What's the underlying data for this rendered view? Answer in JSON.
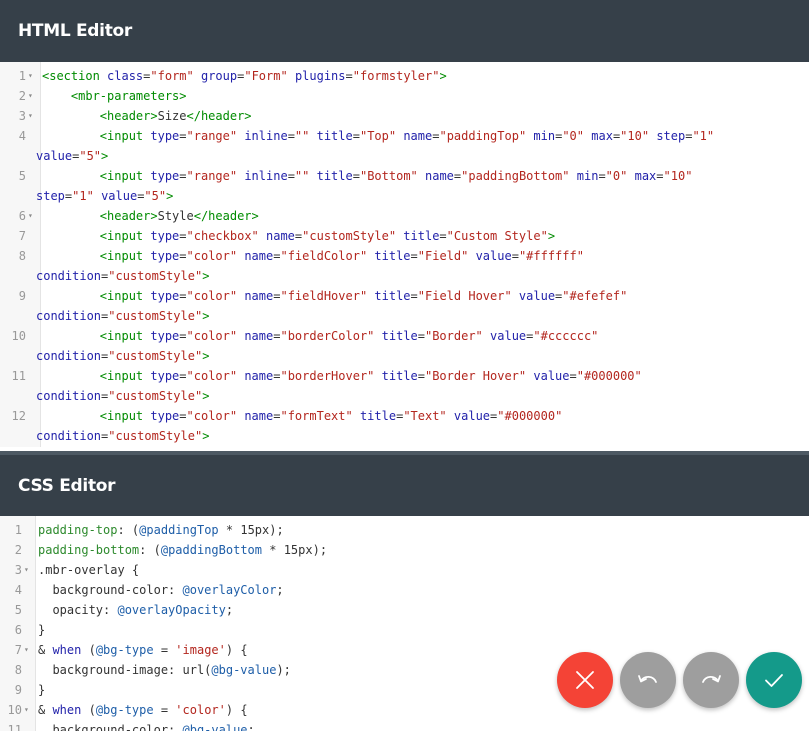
{
  "html_editor": {
    "title": "HTML Editor",
    "lines": [
      {
        "n": "1",
        "fold": true,
        "segments": [
          [
            "t-tag",
            "<section "
          ],
          [
            "t-attr",
            "class"
          ],
          [
            "t-text",
            "="
          ],
          [
            "t-val",
            "\"form\""
          ],
          [
            "t-text",
            " "
          ],
          [
            "t-attr",
            "group"
          ],
          [
            "t-text",
            "="
          ],
          [
            "t-val",
            "\"Form\""
          ],
          [
            "t-text",
            " "
          ],
          [
            "t-attr",
            "plugins"
          ],
          [
            "t-text",
            "="
          ],
          [
            "t-val",
            "\"formstyler\""
          ],
          [
            "t-tag",
            ">"
          ]
        ]
      },
      {
        "n": "2",
        "fold": true,
        "segments": [
          [
            "t-text",
            "    "
          ],
          [
            "t-tag",
            "<mbr-parameters>"
          ]
        ]
      },
      {
        "n": "3",
        "fold": true,
        "segments": [
          [
            "t-text",
            "        "
          ],
          [
            "t-tag",
            "<header>"
          ],
          [
            "t-text",
            "Size"
          ],
          [
            "t-tag",
            "</header>"
          ]
        ]
      },
      {
        "n": "4",
        "fold": false,
        "segments": [
          [
            "t-text",
            "        "
          ],
          [
            "t-tag",
            "<input "
          ],
          [
            "t-attr",
            "type"
          ],
          [
            "t-text",
            "="
          ],
          [
            "t-val",
            "\"range\""
          ],
          [
            "t-text",
            " "
          ],
          [
            "t-attr",
            "inline"
          ],
          [
            "t-text",
            "="
          ],
          [
            "t-val",
            "\"\""
          ],
          [
            "t-text",
            " "
          ],
          [
            "t-attr",
            "title"
          ],
          [
            "t-text",
            "="
          ],
          [
            "t-val",
            "\"Top\""
          ],
          [
            "t-text",
            " "
          ],
          [
            "t-attr",
            "name"
          ],
          [
            "t-text",
            "="
          ],
          [
            "t-val",
            "\"paddingTop\""
          ],
          [
            "t-text",
            " "
          ],
          [
            "t-attr",
            "min"
          ],
          [
            "t-text",
            "="
          ],
          [
            "t-val",
            "\"0\""
          ],
          [
            "t-text",
            " "
          ],
          [
            "t-attr",
            "max"
          ],
          [
            "t-text",
            "="
          ],
          [
            "t-val",
            "\"10\""
          ],
          [
            "t-text",
            " "
          ],
          [
            "t-attr",
            "step"
          ],
          [
            "t-text",
            "="
          ],
          [
            "t-val",
            "\"1\""
          ]
        ],
        "wrap": [
          [
            "t-attr",
            "value"
          ],
          [
            "t-text",
            "="
          ],
          [
            "t-val",
            "\"5\""
          ],
          [
            "t-tag",
            ">"
          ]
        ]
      },
      {
        "n": "5",
        "fold": false,
        "segments": [
          [
            "t-text",
            "        "
          ],
          [
            "t-tag",
            "<input "
          ],
          [
            "t-attr",
            "type"
          ],
          [
            "t-text",
            "="
          ],
          [
            "t-val",
            "\"range\""
          ],
          [
            "t-text",
            " "
          ],
          [
            "t-attr",
            "inline"
          ],
          [
            "t-text",
            "="
          ],
          [
            "t-val",
            "\"\""
          ],
          [
            "t-text",
            " "
          ],
          [
            "t-attr",
            "title"
          ],
          [
            "t-text",
            "="
          ],
          [
            "t-val",
            "\"Bottom\""
          ],
          [
            "t-text",
            " "
          ],
          [
            "t-attr",
            "name"
          ],
          [
            "t-text",
            "="
          ],
          [
            "t-val",
            "\"paddingBottom\""
          ],
          [
            "t-text",
            " "
          ],
          [
            "t-attr",
            "min"
          ],
          [
            "t-text",
            "="
          ],
          [
            "t-val",
            "\"0\""
          ],
          [
            "t-text",
            " "
          ],
          [
            "t-attr",
            "max"
          ],
          [
            "t-text",
            "="
          ],
          [
            "t-val",
            "\"10\""
          ]
        ],
        "wrap": [
          [
            "t-attr",
            "step"
          ],
          [
            "t-text",
            "="
          ],
          [
            "t-val",
            "\"1\""
          ],
          [
            "t-text",
            " "
          ],
          [
            "t-attr",
            "value"
          ],
          [
            "t-text",
            "="
          ],
          [
            "t-val",
            "\"5\""
          ],
          [
            "t-tag",
            ">"
          ]
        ]
      },
      {
        "n": "6",
        "fold": true,
        "segments": [
          [
            "t-text",
            "        "
          ],
          [
            "t-tag",
            "<header>"
          ],
          [
            "t-text",
            "Style"
          ],
          [
            "t-tag",
            "</header>"
          ]
        ]
      },
      {
        "n": "7",
        "fold": false,
        "segments": [
          [
            "t-text",
            "        "
          ],
          [
            "t-tag",
            "<input "
          ],
          [
            "t-attr",
            "type"
          ],
          [
            "t-text",
            "="
          ],
          [
            "t-val",
            "\"checkbox\""
          ],
          [
            "t-text",
            " "
          ],
          [
            "t-attr",
            "name"
          ],
          [
            "t-text",
            "="
          ],
          [
            "t-val",
            "\"customStyle\""
          ],
          [
            "t-text",
            " "
          ],
          [
            "t-attr",
            "title"
          ],
          [
            "t-text",
            "="
          ],
          [
            "t-val",
            "\"Custom Style\""
          ],
          [
            "t-tag",
            ">"
          ]
        ]
      },
      {
        "n": "8",
        "fold": false,
        "segments": [
          [
            "t-text",
            "        "
          ],
          [
            "t-tag",
            "<input "
          ],
          [
            "t-attr",
            "type"
          ],
          [
            "t-text",
            "="
          ],
          [
            "t-val",
            "\"color\""
          ],
          [
            "t-text",
            " "
          ],
          [
            "t-attr",
            "name"
          ],
          [
            "t-text",
            "="
          ],
          [
            "t-val",
            "\"fieldColor\""
          ],
          [
            "t-text",
            " "
          ],
          [
            "t-attr",
            "title"
          ],
          [
            "t-text",
            "="
          ],
          [
            "t-val",
            "\"Field\""
          ],
          [
            "t-text",
            " "
          ],
          [
            "t-attr",
            "value"
          ],
          [
            "t-text",
            "="
          ],
          [
            "t-val",
            "\"#ffffff\""
          ]
        ],
        "wrap": [
          [
            "t-attr",
            "condition"
          ],
          [
            "t-text",
            "="
          ],
          [
            "t-val",
            "\"customStyle\""
          ],
          [
            "t-tag",
            ">"
          ]
        ]
      },
      {
        "n": "9",
        "fold": false,
        "segments": [
          [
            "t-text",
            "        "
          ],
          [
            "t-tag",
            "<input "
          ],
          [
            "t-attr",
            "type"
          ],
          [
            "t-text",
            "="
          ],
          [
            "t-val",
            "\"color\""
          ],
          [
            "t-text",
            " "
          ],
          [
            "t-attr",
            "name"
          ],
          [
            "t-text",
            "="
          ],
          [
            "t-val",
            "\"fieldHover\""
          ],
          [
            "t-text",
            " "
          ],
          [
            "t-attr",
            "title"
          ],
          [
            "t-text",
            "="
          ],
          [
            "t-val",
            "\"Field Hover\""
          ],
          [
            "t-text",
            " "
          ],
          [
            "t-attr",
            "value"
          ],
          [
            "t-text",
            "="
          ],
          [
            "t-val",
            "\"#efefef\""
          ]
        ],
        "wrap": [
          [
            "t-attr",
            "condition"
          ],
          [
            "t-text",
            "="
          ],
          [
            "t-val",
            "\"customStyle\""
          ],
          [
            "t-tag",
            ">"
          ]
        ]
      },
      {
        "n": "10",
        "fold": false,
        "segments": [
          [
            "t-text",
            "        "
          ],
          [
            "t-tag",
            "<input "
          ],
          [
            "t-attr",
            "type"
          ],
          [
            "t-text",
            "="
          ],
          [
            "t-val",
            "\"color\""
          ],
          [
            "t-text",
            " "
          ],
          [
            "t-attr",
            "name"
          ],
          [
            "t-text",
            "="
          ],
          [
            "t-val",
            "\"borderColor\""
          ],
          [
            "t-text",
            " "
          ],
          [
            "t-attr",
            "title"
          ],
          [
            "t-text",
            "="
          ],
          [
            "t-val",
            "\"Border\""
          ],
          [
            "t-text",
            " "
          ],
          [
            "t-attr",
            "value"
          ],
          [
            "t-text",
            "="
          ],
          [
            "t-val",
            "\"#cccccc\""
          ]
        ],
        "wrap": [
          [
            "t-attr",
            "condition"
          ],
          [
            "t-text",
            "="
          ],
          [
            "t-val",
            "\"customStyle\""
          ],
          [
            "t-tag",
            ">"
          ]
        ]
      },
      {
        "n": "11",
        "fold": false,
        "segments": [
          [
            "t-text",
            "        "
          ],
          [
            "t-tag",
            "<input "
          ],
          [
            "t-attr",
            "type"
          ],
          [
            "t-text",
            "="
          ],
          [
            "t-val",
            "\"color\""
          ],
          [
            "t-text",
            " "
          ],
          [
            "t-attr",
            "name"
          ],
          [
            "t-text",
            "="
          ],
          [
            "t-val",
            "\"borderHover\""
          ],
          [
            "t-text",
            " "
          ],
          [
            "t-attr",
            "title"
          ],
          [
            "t-text",
            "="
          ],
          [
            "t-val",
            "\"Border Hover\""
          ],
          [
            "t-text",
            " "
          ],
          [
            "t-attr",
            "value"
          ],
          [
            "t-text",
            "="
          ],
          [
            "t-val",
            "\"#000000\""
          ]
        ],
        "wrap": [
          [
            "t-attr",
            "condition"
          ],
          [
            "t-text",
            "="
          ],
          [
            "t-val",
            "\"customStyle\""
          ],
          [
            "t-tag",
            ">"
          ]
        ]
      },
      {
        "n": "12",
        "fold": false,
        "segments": [
          [
            "t-text",
            "        "
          ],
          [
            "t-tag",
            "<input "
          ],
          [
            "t-attr",
            "type"
          ],
          [
            "t-text",
            "="
          ],
          [
            "t-val",
            "\"color\""
          ],
          [
            "t-text",
            " "
          ],
          [
            "t-attr",
            "name"
          ],
          [
            "t-text",
            "="
          ],
          [
            "t-val",
            "\"formText\""
          ],
          [
            "t-text",
            " "
          ],
          [
            "t-attr",
            "title"
          ],
          [
            "t-text",
            "="
          ],
          [
            "t-val",
            "\"Text\""
          ],
          [
            "t-text",
            " "
          ],
          [
            "t-attr",
            "value"
          ],
          [
            "t-text",
            "="
          ],
          [
            "t-val",
            "\"#000000\""
          ]
        ],
        "wrap": [
          [
            "t-attr",
            "condition"
          ],
          [
            "t-text",
            "="
          ],
          [
            "t-val",
            "\"customStyle\""
          ],
          [
            "t-tag",
            ">"
          ]
        ]
      }
    ]
  },
  "css_editor": {
    "title": "CSS Editor",
    "lines": [
      {
        "n": "1",
        "fold": false,
        "segments": [
          [
            "t-prop",
            "padding-top"
          ],
          [
            "t-text",
            ": ("
          ],
          [
            "t-var",
            "@paddingTop"
          ],
          [
            "t-text",
            " * "
          ],
          [
            "t-num",
            "15px"
          ],
          [
            "t-text",
            ");"
          ]
        ]
      },
      {
        "n": "2",
        "fold": false,
        "segments": [
          [
            "t-prop",
            "padding-bottom"
          ],
          [
            "t-text",
            ": ("
          ],
          [
            "t-var",
            "@paddingBottom"
          ],
          [
            "t-text",
            " * "
          ],
          [
            "t-num",
            "15px"
          ],
          [
            "t-text",
            ");"
          ]
        ]
      },
      {
        "n": "3",
        "fold": true,
        "segments": [
          [
            "t-text",
            ".mbr-overlay {"
          ]
        ]
      },
      {
        "n": "4",
        "fold": false,
        "segments": [
          [
            "t-text",
            "  background-color: "
          ],
          [
            "t-var",
            "@overlayColor"
          ],
          [
            "t-text",
            ";"
          ]
        ]
      },
      {
        "n": "5",
        "fold": false,
        "segments": [
          [
            "t-text",
            "  opacity: "
          ],
          [
            "t-var",
            "@overlayOpacity"
          ],
          [
            "t-text",
            ";"
          ]
        ]
      },
      {
        "n": "6",
        "fold": false,
        "segments": [
          [
            "t-text",
            "}"
          ]
        ]
      },
      {
        "n": "7",
        "fold": true,
        "segments": [
          [
            "t-text",
            "& "
          ],
          [
            "t-kw",
            "when"
          ],
          [
            "t-text",
            " ("
          ],
          [
            "t-var",
            "@bg-type"
          ],
          [
            "t-text",
            " = "
          ],
          [
            "t-str",
            "'image'"
          ],
          [
            "t-text",
            ") {"
          ]
        ]
      },
      {
        "n": "8",
        "fold": false,
        "segments": [
          [
            "t-text",
            "  background-image: url("
          ],
          [
            "t-var",
            "@bg-value"
          ],
          [
            "t-text",
            ");"
          ]
        ]
      },
      {
        "n": "9",
        "fold": false,
        "segments": [
          [
            "t-text",
            "}"
          ]
        ]
      },
      {
        "n": "10",
        "fold": true,
        "segments": [
          [
            "t-text",
            "& "
          ],
          [
            "t-kw",
            "when"
          ],
          [
            "t-text",
            " ("
          ],
          [
            "t-var",
            "@bg-type"
          ],
          [
            "t-text",
            " = "
          ],
          [
            "t-str",
            "'color'"
          ],
          [
            "t-text",
            ") {"
          ]
        ]
      },
      {
        "n": "11",
        "fold": false,
        "segments": [
          [
            "t-text",
            "  background-color: "
          ],
          [
            "t-var",
            "@bg-value"
          ],
          [
            "t-text",
            ";"
          ]
        ]
      }
    ]
  },
  "actions": {
    "close": {
      "icon": "close-icon",
      "color": "#f44336"
    },
    "undo": {
      "icon": "undo-icon",
      "color": "#9e9e9e"
    },
    "redo": {
      "icon": "redo-icon",
      "color": "#9e9e9e"
    },
    "apply": {
      "icon": "check-icon",
      "color": "#149a8a"
    }
  },
  "colors": {
    "header_bg": "#364049",
    "divider": "#4d5963",
    "gutter_bg": "#f7f7f7"
  }
}
